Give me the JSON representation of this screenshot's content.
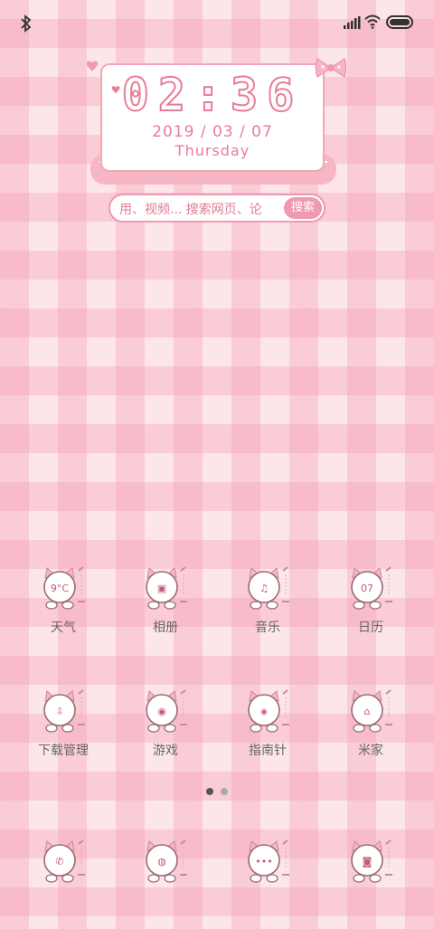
{
  "widget": {
    "time": "02:36",
    "date": "2019 / 03 / 07",
    "weekday": "Thursday"
  },
  "search": {
    "text": "用、视频...      搜索网页、论",
    "button": "搜索"
  },
  "apps": {
    "row1": [
      {
        "label": "天气",
        "icon": "weather-icon",
        "glyph": "9°C"
      },
      {
        "label": "相册",
        "icon": "gallery-icon",
        "glyph": "▣"
      },
      {
        "label": "音乐",
        "icon": "music-icon",
        "glyph": "♫"
      },
      {
        "label": "日历",
        "icon": "calendar-icon",
        "glyph": "07"
      }
    ],
    "row2": [
      {
        "label": "下载管理",
        "icon": "download-icon",
        "glyph": "⇩"
      },
      {
        "label": "游戏",
        "icon": "game-icon",
        "glyph": "◉"
      },
      {
        "label": "指南针",
        "icon": "compass-icon",
        "glyph": "◈"
      },
      {
        "label": "米家",
        "icon": "mi-home-icon",
        "glyph": "⌂"
      }
    ],
    "dock": [
      {
        "icon": "phone-icon",
        "glyph": "✆"
      },
      {
        "icon": "browser-icon",
        "glyph": "◍"
      },
      {
        "icon": "messages-icon",
        "glyph": "•••"
      },
      {
        "icon": "camera-icon",
        "glyph": "◙"
      }
    ]
  },
  "colors": {
    "accent": "#ee9ab0",
    "accent_dark": "#e87c97",
    "label": "#666666"
  }
}
